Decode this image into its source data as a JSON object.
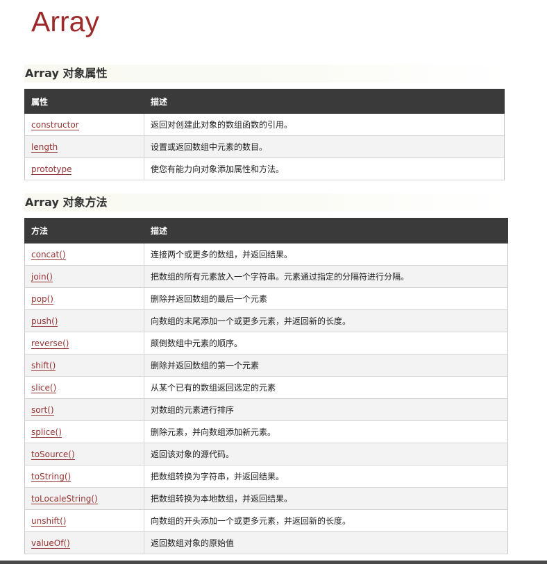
{
  "title": "Array",
  "properties": {
    "heading": "Array 对象属性",
    "headers": [
      "属性",
      "描述"
    ],
    "rows": [
      {
        "name": "constructor",
        "desc": "返回对创建此对象的数组函数的引用。"
      },
      {
        "name": "length",
        "desc": "设置或返回数组中元素的数目。"
      },
      {
        "name": "prototype",
        "desc": "使您有能力向对象添加属性和方法。"
      }
    ]
  },
  "methods": {
    "heading": "Array 对象方法",
    "headers": [
      "方法",
      "描述"
    ],
    "rows": [
      {
        "name": "concat()",
        "desc": "连接两个或更多的数组，并返回结果。"
      },
      {
        "name": "join()",
        "desc": "把数组的所有元素放入一个字符串。元素通过指定的分隔符进行分隔。"
      },
      {
        "name": "pop()",
        "desc": "删除并返回数组的最后一个元素"
      },
      {
        "name": "push()",
        "desc": "向数组的末尾添加一个或更多元素，并返回新的长度。"
      },
      {
        "name": "reverse()",
        "desc": "颠倒数组中元素的顺序。"
      },
      {
        "name": "shift()",
        "desc": "删除并返回数组的第一个元素"
      },
      {
        "name": "slice()",
        "desc": "从某个已有的数组返回选定的元素"
      },
      {
        "name": "sort()",
        "desc": "对数组的元素进行排序"
      },
      {
        "name": "splice()",
        "desc": "删除元素，并向数组添加新元素。"
      },
      {
        "name": "toSource()",
        "desc": "返回该对象的源代码。"
      },
      {
        "name": "toString()",
        "desc": "把数组转换为字符串，并返回结果。"
      },
      {
        "name": "toLocaleString()",
        "desc": "把数组转换为本地数组，并返回结果。"
      },
      {
        "name": "unshift()",
        "desc": "向数组的开头添加一个或更多元素，并返回新的长度。"
      },
      {
        "name": "valueOf()",
        "desc": "返回数组对象的原始值"
      }
    ]
  },
  "colors": {
    "title": "#9d2a2a",
    "link": "#963333",
    "table_header_bg": "#3a3a3a",
    "row_alt_bg": "#f3f3f3"
  }
}
